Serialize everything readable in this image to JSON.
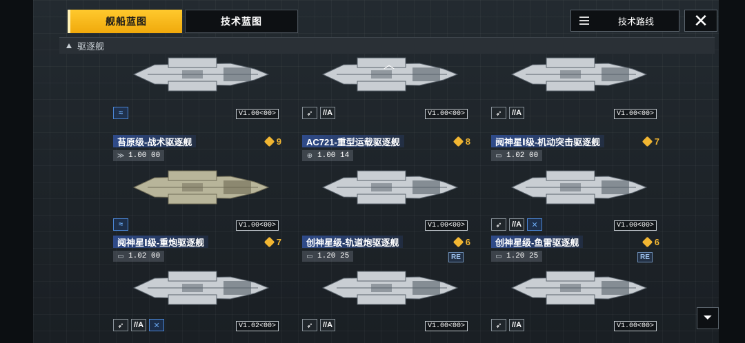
{
  "tabs": {
    "ship_blueprint": "舰船蓝图",
    "tech_blueprint": "技术蓝图"
  },
  "route_button": "技术路线",
  "close_symbol": "✕",
  "category": "驱逐舰",
  "filter_symbol": "⏷",
  "scroll_chevron": "︿",
  "accent_color": "#f0a90c",
  "top_row": [
    {
      "version": "V1.00<00>",
      "tags": [
        "wave"
      ]
    },
    {
      "version": "V1.00<00>",
      "tags": [
        "strike",
        "A"
      ]
    },
    {
      "version": "V1.00<00>",
      "tags": [
        "strike",
        "A"
      ]
    }
  ],
  "ships": [
    {
      "name": "苔原级-战术驱逐舰",
      "cost": "9",
      "stat": "1.00  00",
      "stat_icon": "speed",
      "version": "V1.00<00>",
      "tags": [
        "wave"
      ],
      "re": ""
    },
    {
      "name": "AC721-重型运载驱逐舰",
      "cost": "8",
      "stat": "1.00  14",
      "stat_icon": "globe",
      "version": "V1.00<00>",
      "tags": [],
      "re": ""
    },
    {
      "name": "阋神星Ⅰ级-机动突击驱逐舰",
      "cost": "7",
      "stat": "1.02  00",
      "stat_icon": "armor",
      "version": "V1.00<00>",
      "tags": [
        "strike",
        "A",
        "cross"
      ],
      "re": ""
    },
    {
      "name": "阋神星Ⅰ级-重炮驱逐舰",
      "cost": "7",
      "stat": "1.02  00",
      "stat_icon": "armor",
      "version": "V1.02<00>",
      "tags": [
        "strike",
        "A",
        "cross"
      ],
      "re": ""
    },
    {
      "name": "创神星级-轨道炮驱逐舰",
      "cost": "6",
      "stat": "1.20  25",
      "stat_icon": "armor",
      "version": "V1.00<00>",
      "tags": [
        "strike",
        "A"
      ],
      "re": "RE"
    },
    {
      "name": "创神星级-鱼雷驱逐舰",
      "cost": "6",
      "stat": "1.20  25",
      "stat_icon": "armor",
      "version": "V1.00<00>",
      "tags": [
        "strike",
        "A"
      ],
      "re": "RE"
    }
  ]
}
